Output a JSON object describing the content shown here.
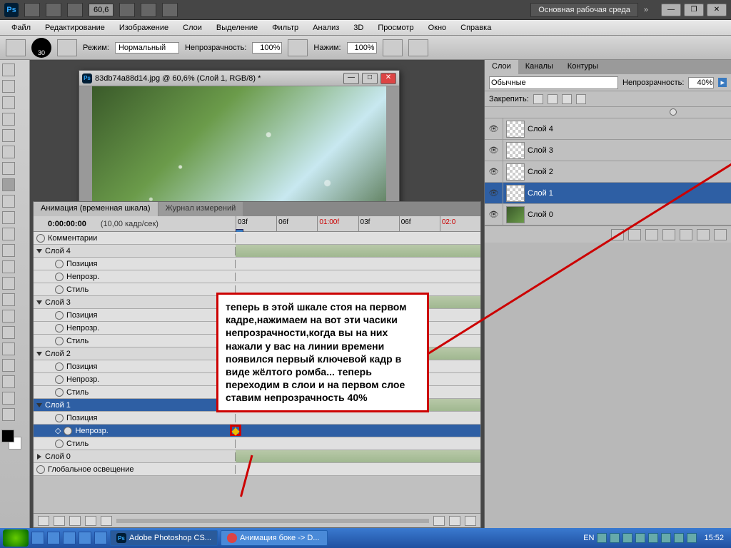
{
  "topbar": {
    "zoom_value": "60,6",
    "workspace": "Основная рабочая среда"
  },
  "menu": [
    "Файл",
    "Редактирование",
    "Изображение",
    "Слои",
    "Выделение",
    "Фильтр",
    "Анализ",
    "3D",
    "Просмотр",
    "Окно",
    "Справка"
  ],
  "optionbar": {
    "brush_size": "30",
    "mode_label": "Режим:",
    "mode_value": "Нормальный",
    "opacity_label": "Непрозрачность:",
    "opacity_value": "100%",
    "flow_label": "Нажим:",
    "flow_value": "100%"
  },
  "document": {
    "title": "83db74a88d14.jpg @ 60,6% (Слой 1, RGB/8) *"
  },
  "animation": {
    "tab_active": "Анимация (временная шкала)",
    "tab_inactive": "Журнал измерений",
    "timecode": "0:00:00:00",
    "fps": "(10,00 кадр/сек)",
    "ticks": [
      "03f",
      "06f",
      "01:00f",
      "03f",
      "06f",
      "02:0"
    ],
    "rows": {
      "comments": "Комментарии",
      "layer4": "Слой 4",
      "layer3": "Слой 3",
      "layer2": "Слой 2",
      "layer1": "Слой 1",
      "layer0": "Слой 0",
      "position": "Позиция",
      "opacity": "Непрозр.",
      "style": "Стиль",
      "global": "Глобальное освещение"
    }
  },
  "annotation": {
    "text": "теперь в этой шкале стоя на первом кадре,нажимаем на вот эти часики непрозрачности,когда вы на них нажали у вас на линии времени появился первый ключевой кадр в виде жёлтого ромба... теперь переходим в слои и на первом слое ставим непрозрачность  40%"
  },
  "layers_panel": {
    "tabs": [
      "Слои",
      "Каналы",
      "Контуры"
    ],
    "blend_mode": "Обычные",
    "opacity_label": "Непрозрачность:",
    "opacity_value": "40%",
    "lock_label": "Закрепить:",
    "layers": [
      {
        "name": "Слой 4",
        "sel": false,
        "thumb": "checker"
      },
      {
        "name": "Слой 3",
        "sel": false,
        "thumb": "checker"
      },
      {
        "name": "Слой 2",
        "sel": false,
        "thumb": "checker"
      },
      {
        "name": "Слой 1",
        "sel": true,
        "thumb": "checker"
      },
      {
        "name": "Слой 0",
        "sel": false,
        "thumb": "img"
      }
    ]
  },
  "taskbar": {
    "task1": "Adobe Photoshop CS...",
    "task2": "Анимация боке -> D...",
    "lang": "EN",
    "clock": "15:52"
  }
}
